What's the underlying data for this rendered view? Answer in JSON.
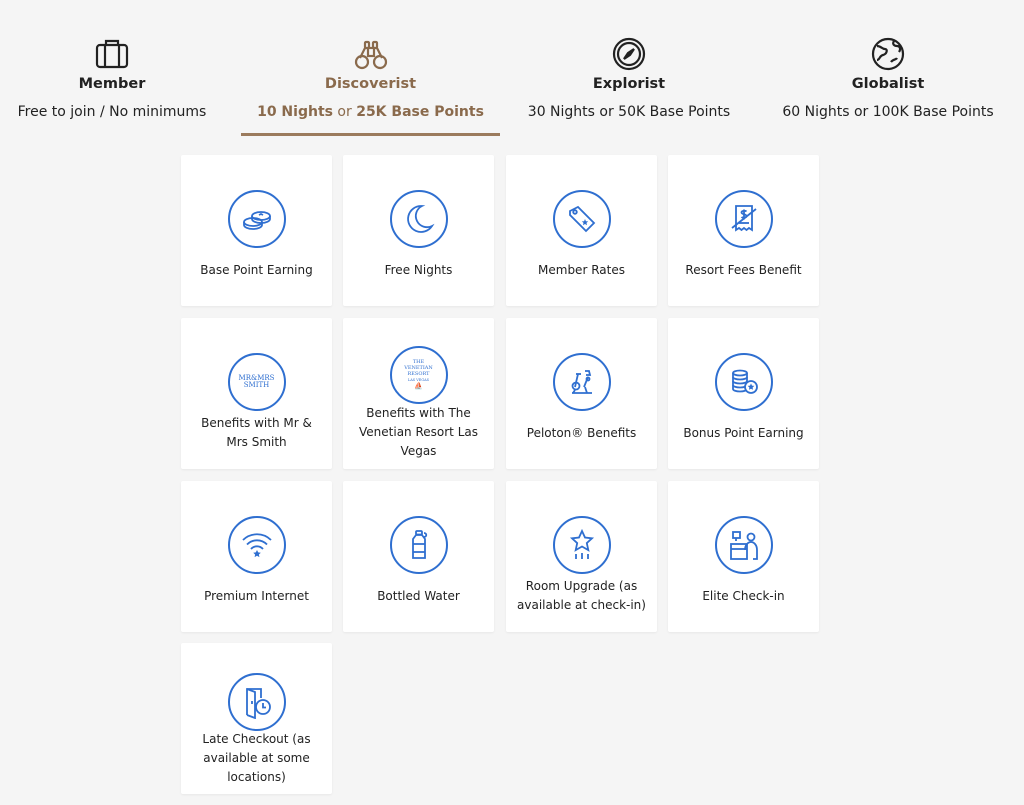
{
  "tiers": [
    {
      "name": "Member",
      "requirement": "Free to join / No minimums",
      "icon": "briefcase-icon"
    },
    {
      "name": "Discoverist",
      "req_part1": "10 Nights",
      "req_sep": " or ",
      "req_part2": "25K Base Points",
      "icon": "binoculars-icon",
      "active": true
    },
    {
      "name": "Explorist",
      "requirement": "30 Nights or 50K Base Points",
      "icon": "compass-icon"
    },
    {
      "name": "Globalist",
      "requirement": "60 Nights or 100K Base Points",
      "icon": "globe-icon"
    }
  ],
  "benefits": [
    {
      "label": "Base Point Earning",
      "icon": "coins-icon"
    },
    {
      "label": "Free Nights",
      "icon": "moon-icon"
    },
    {
      "label": "Member Rates",
      "icon": "price-tag-icon"
    },
    {
      "label": "Resort Fees Benefit",
      "icon": "no-fee-receipt-icon"
    },
    {
      "label": "Benefits with Mr & Mrs Smith",
      "icon": "mr-mrs-smith-logo",
      "logo_line1": "MR&MRS",
      "logo_line2": "SMITH"
    },
    {
      "label": "Benefits with The Venetian Resort Las Vegas",
      "icon": "venetian-resort-logo",
      "logo_line1": "THE",
      "logo_line2": "VENETIAN",
      "logo_line3": "RESORT",
      "logo_line4": "LAS VEGAS"
    },
    {
      "label": "Peloton® Benefits",
      "icon": "exercise-bike-icon"
    },
    {
      "label": "Bonus Point Earning",
      "icon": "coin-stack-star-icon"
    },
    {
      "label": "Premium Internet",
      "icon": "wifi-star-icon"
    },
    {
      "label": "Bottled Water",
      "icon": "water-bottle-icon"
    },
    {
      "label": "Room Upgrade (as available at check-in)",
      "icon": "star-upgrade-icon"
    },
    {
      "label": "Elite Check-in",
      "icon": "front-desk-icon"
    },
    {
      "label": "Late Checkout (as available at some locations)",
      "icon": "door-clock-icon"
    }
  ],
  "colors": {
    "accent_blue": "#2f6fd0",
    "active_tier_brown": "#8a6a4c",
    "background": "#f5f5f5",
    "card": "#ffffff"
  }
}
